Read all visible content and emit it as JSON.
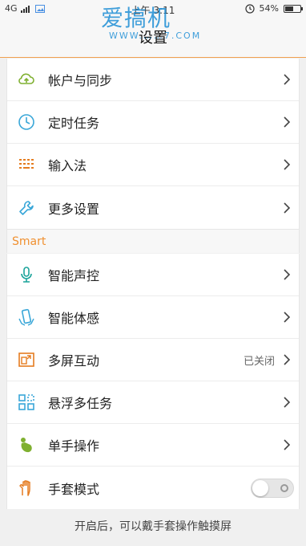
{
  "status_bar": {
    "network": "4G",
    "time": "上午 3:11",
    "battery": "54%",
    "battery_level": 0.54
  },
  "header": {
    "title": "设置"
  },
  "watermark": {
    "text": "爱搞机",
    "sub": "WWW.……7.COM"
  },
  "group1": {
    "items": [
      {
        "label": "帐户与同步",
        "icon": "cloud-sync-icon"
      },
      {
        "label": "定时任务",
        "icon": "clock-icon"
      },
      {
        "label": "输入法",
        "icon": "keyboard-icon"
      },
      {
        "label": "更多设置",
        "icon": "wrench-icon"
      }
    ]
  },
  "section": {
    "title": "Smart"
  },
  "group2": {
    "items": [
      {
        "label": "智能声控",
        "icon": "microphone-icon"
      },
      {
        "label": "智能体感",
        "icon": "phone-motion-icon"
      },
      {
        "label": "多屏互动",
        "icon": "multi-screen-icon",
        "status": "已关闭"
      },
      {
        "label": "悬浮多任务",
        "icon": "floating-task-icon"
      },
      {
        "label": "单手操作",
        "icon": "one-hand-icon"
      },
      {
        "label": "手套模式",
        "icon": "glove-icon",
        "toggle": false
      }
    ]
  },
  "footer": {
    "note": "开启后，可以戴手套操作触摸屏"
  },
  "colors": {
    "accent": "#f09030",
    "icon_teal": "#1aa39a",
    "icon_blue": "#3aa7d8",
    "icon_orange": "#e57c20",
    "icon_green": "#7fb030"
  }
}
